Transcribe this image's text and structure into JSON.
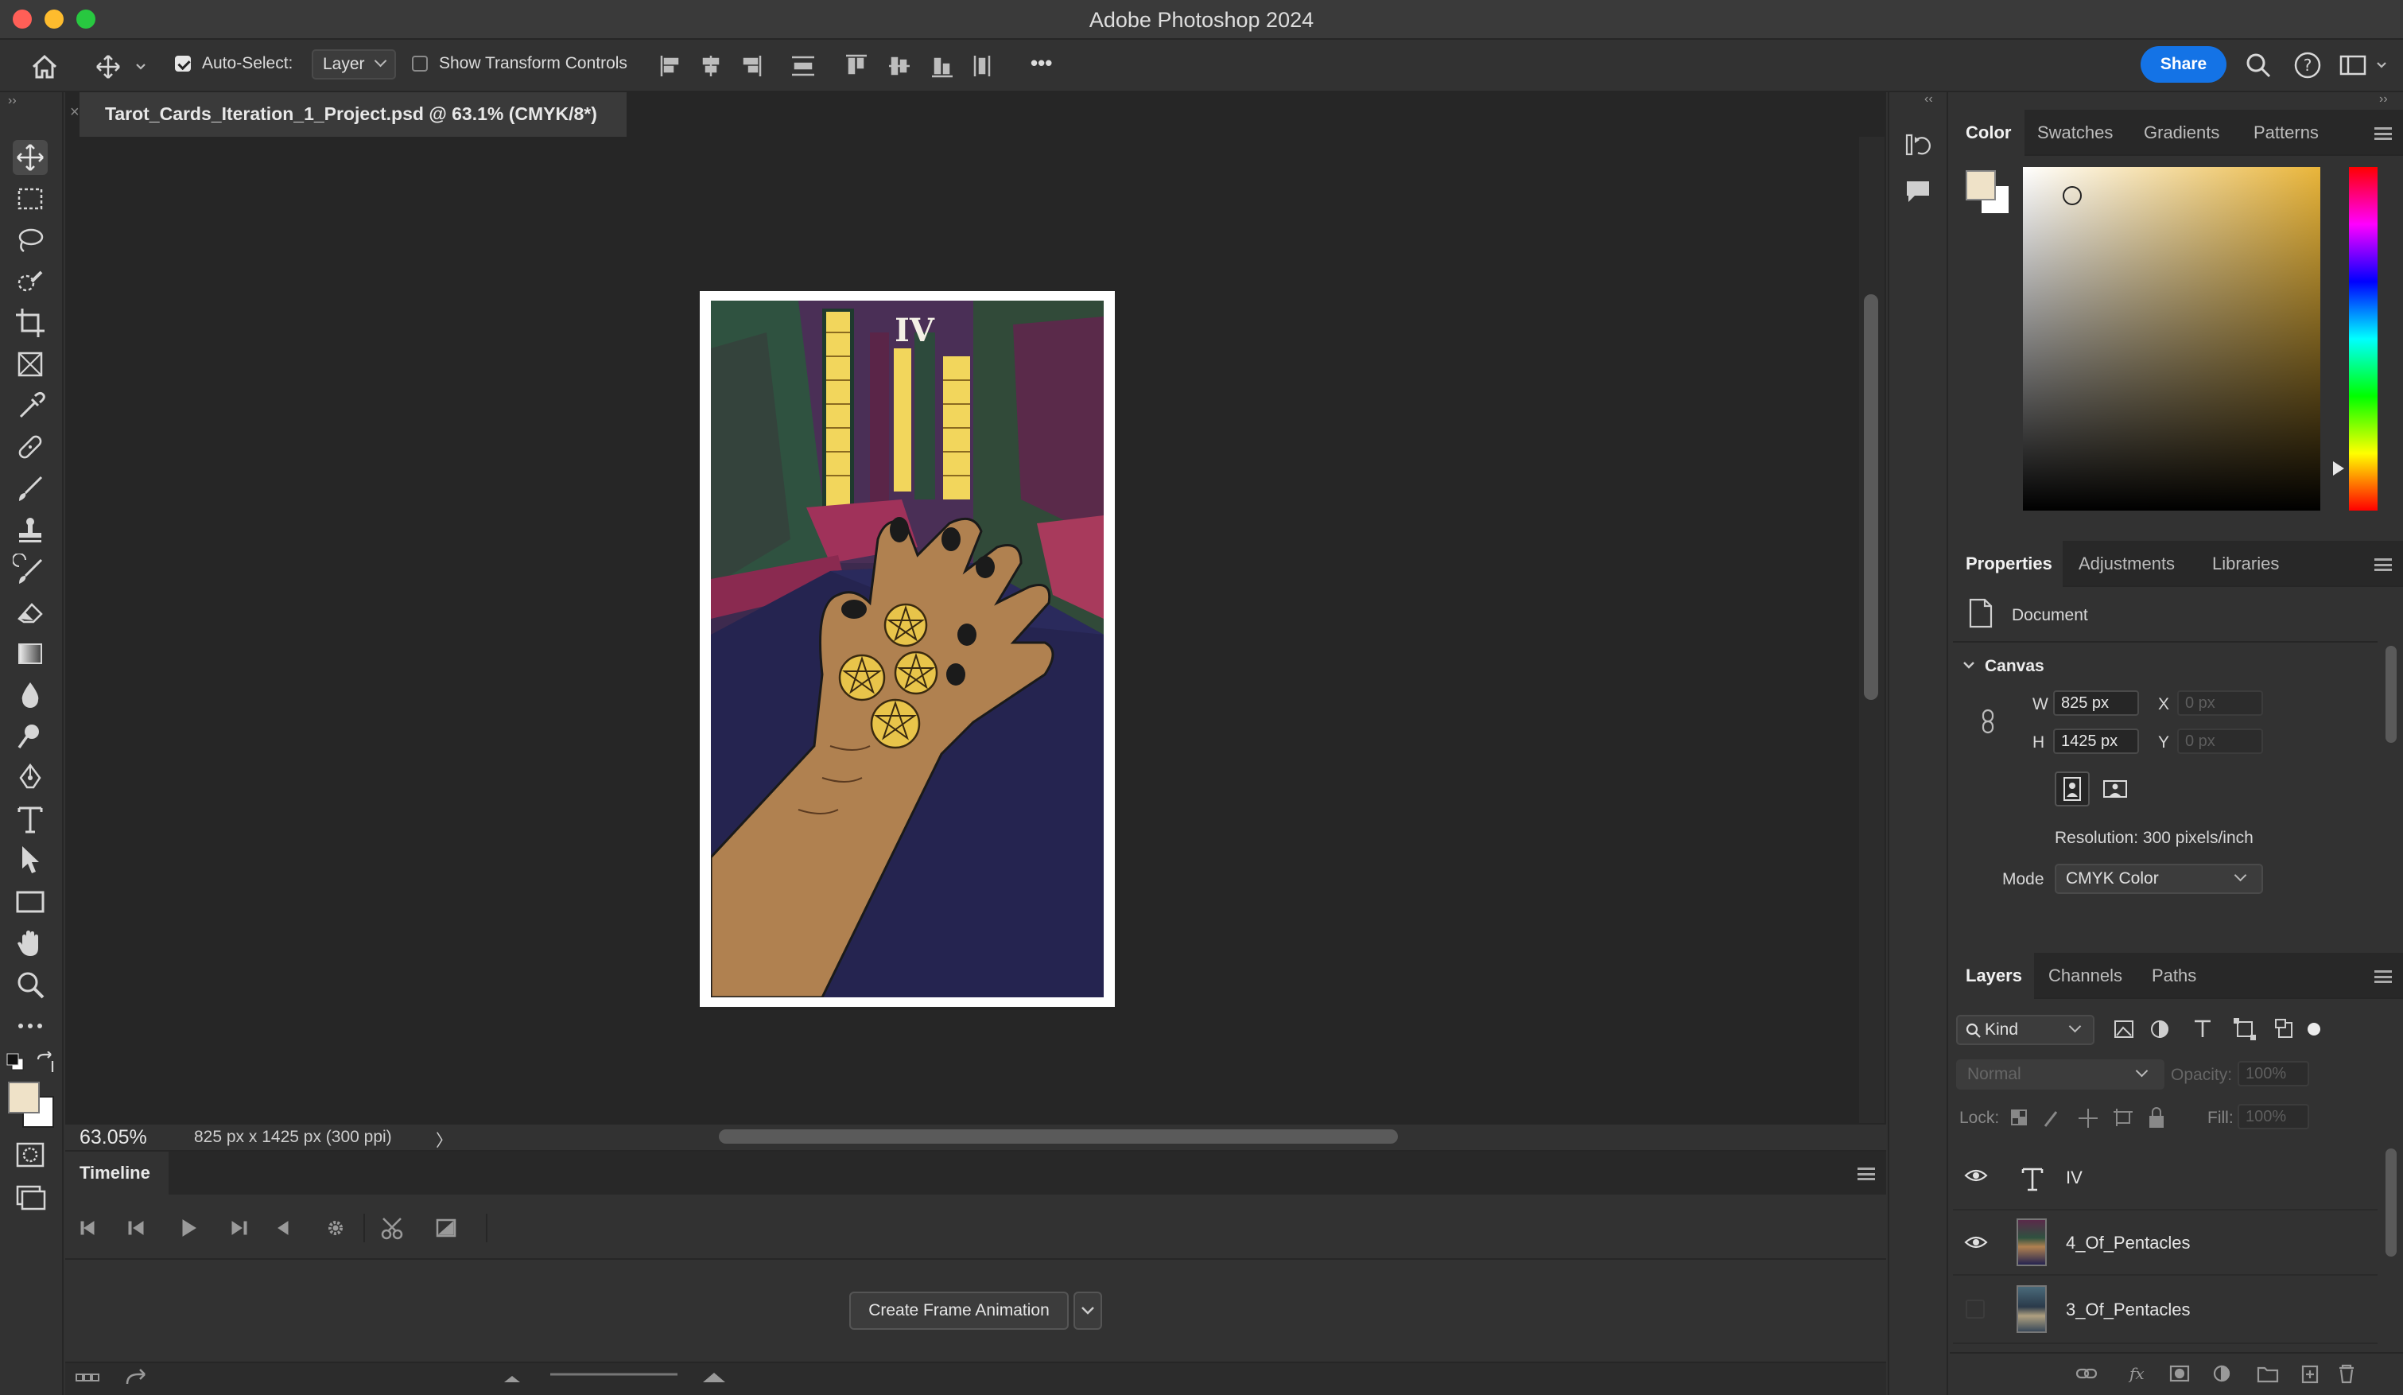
{
  "app": {
    "title": "Adobe Photoshop 2024",
    "traffic_colors": [
      "#ff5f57",
      "#febc2e",
      "#28c840"
    ]
  },
  "options_bar": {
    "auto_select_label": "Auto-Select:",
    "auto_select_checked": true,
    "auto_select_value": "Layer",
    "show_transform_label": "Show Transform Controls",
    "show_transform_checked": false,
    "more_label": "•••",
    "share_label": "Share"
  },
  "document": {
    "tab_title": "Tarot_Cards_Iteration_1_Project.psd @ 63.1% (CMYK/8*)",
    "card_numeral": "IV",
    "zoom": "63.05%",
    "doc_size": "825 px x 1425 px (300 ppi)",
    "status_arrow": "〉"
  },
  "timeline": {
    "title": "Timeline",
    "create_button": "Create Frame Animation"
  },
  "color_panel": {
    "tabs": [
      "Color",
      "Swatches",
      "Gradients",
      "Patterns"
    ],
    "active_tab": "Color",
    "foreground": "#efe2c8",
    "background": "#ffffff"
  },
  "properties_panel": {
    "tabs": [
      "Properties",
      "Adjustments",
      "Libraries"
    ],
    "active_tab": "Properties",
    "document_label": "Document",
    "section_title": "Canvas",
    "w_label": "W",
    "w_value": "825 px",
    "h_label": "H",
    "h_value": "1425 px",
    "x_label": "X",
    "x_placeholder": "0 px",
    "y_label": "Y",
    "y_placeholder": "0 px",
    "resolution": "Resolution: 300 pixels/inch",
    "mode_label": "Mode",
    "mode_value": "CMYK Color"
  },
  "layers_panel": {
    "tabs": [
      "Layers",
      "Channels",
      "Paths"
    ],
    "active_tab": "Layers",
    "filter_kind": "Kind",
    "blend_mode": "Normal",
    "opacity_label": "Opacity:",
    "opacity_value": "100%",
    "lock_label": "Lock:",
    "fill_label": "Fill:",
    "fill_value": "100%",
    "layers": [
      {
        "name": "IV",
        "type": "text",
        "visible": true
      },
      {
        "name": "4_Of_Pentacles",
        "type": "image",
        "visible": true
      },
      {
        "name": "3_Of_Pentacles",
        "type": "image",
        "visible": false
      }
    ]
  }
}
